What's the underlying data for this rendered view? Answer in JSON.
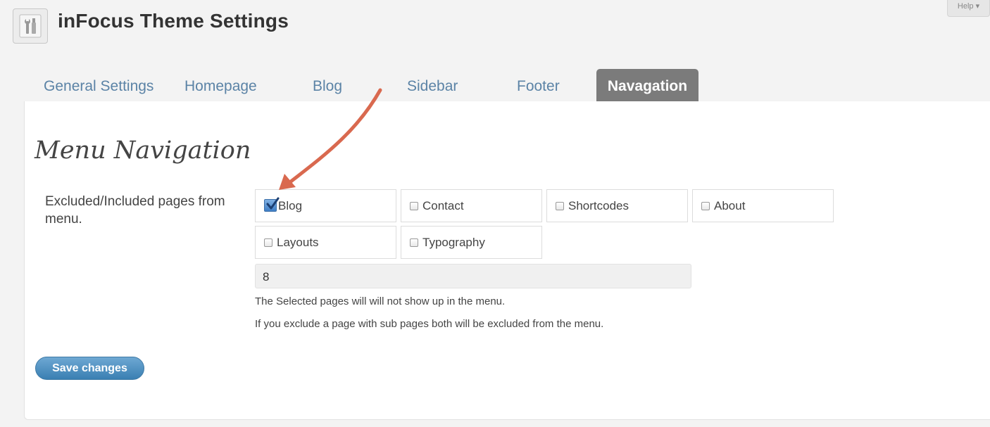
{
  "header": {
    "title": "inFocus Theme Settings",
    "help_label": "Help ▾"
  },
  "tabs": [
    {
      "label": "General Settings",
      "active": false
    },
    {
      "label": "Homepage",
      "active": false
    },
    {
      "label": "Blog",
      "active": false
    },
    {
      "label": "Sidebar",
      "active": false
    },
    {
      "label": "Footer",
      "active": false
    },
    {
      "label": "Navagation",
      "active": true
    }
  ],
  "section": {
    "title": "Menu Navigation",
    "field_label": "Excluded/Included pages from menu.",
    "pages": [
      {
        "label": "Blog",
        "checked": true
      },
      {
        "label": "Contact",
        "checked": false
      },
      {
        "label": "Shortcodes",
        "checked": false
      },
      {
        "label": "About",
        "checked": false
      },
      {
        "label": "Layouts",
        "checked": false
      },
      {
        "label": "Typography",
        "checked": false
      }
    ],
    "count_value": "8",
    "help_line_1": "The Selected pages will will not show up in the menu.",
    "help_line_2": "If you exclude a page with sub pages both will be excluded from the menu."
  },
  "actions": {
    "save_label": "Save changes"
  },
  "colors": {
    "tab_link": "#5b83a6",
    "tab_active_bg": "#7b7b7b",
    "button": "#3a7fb2",
    "annotation_arrow": "#d9694f"
  }
}
